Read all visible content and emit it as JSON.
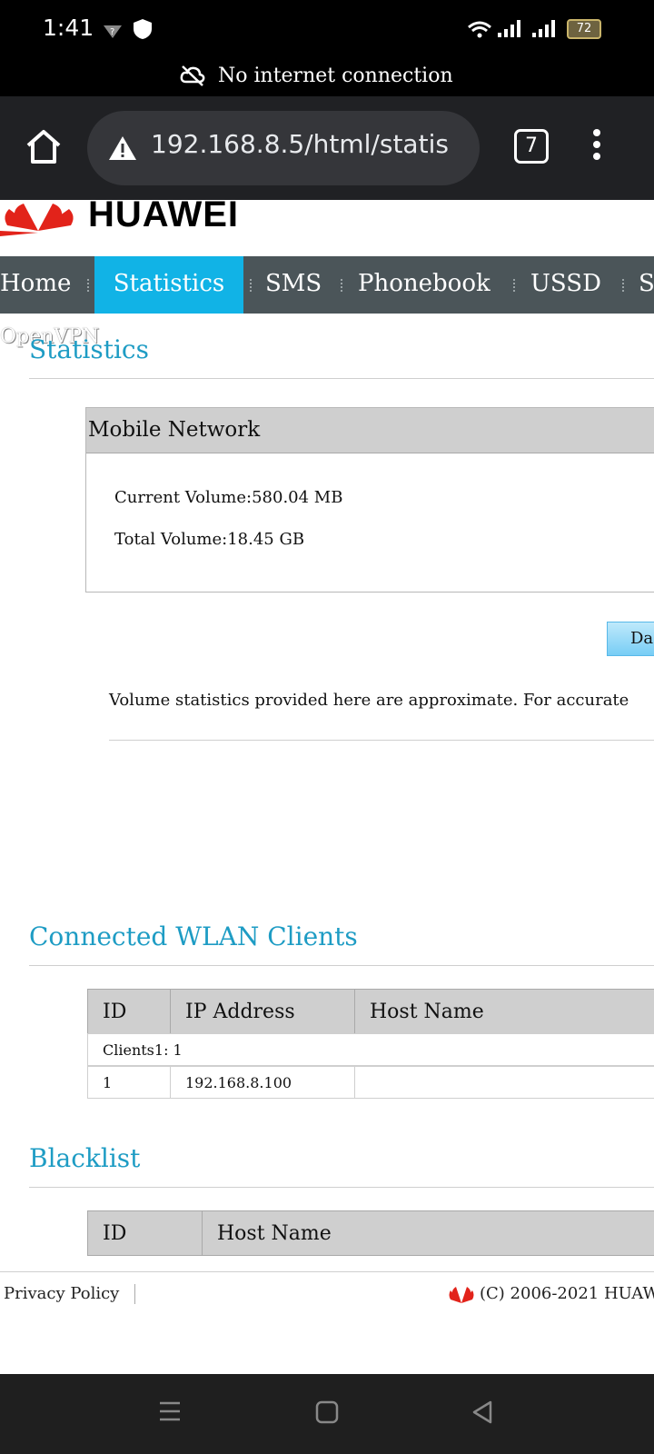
{
  "status_bar": {
    "time": "1:41",
    "battery": "72",
    "icons": [
      "vpn-key-icon",
      "shield-icon",
      "wifi-icon",
      "signal-icon",
      "signal-icon",
      "battery-icon"
    ]
  },
  "network_banner": {
    "text": "No internet connection",
    "icon": "cloud-off-icon"
  },
  "browser": {
    "url": "192.168.8.5/html/statis",
    "tab_count": "7"
  },
  "site": {
    "brand": "HUAWEI",
    "nav": [
      "Home",
      "Statistics",
      "SMS",
      "Phonebook",
      "USSD",
      "S"
    ],
    "active_nav": "Statistics",
    "overlay_text": "OpenVPN"
  },
  "statistics": {
    "title": "Statistics",
    "panel_title": "Mobile Network",
    "current_volume": "Current Volume:580.04 MB",
    "total_volume": "Total Volume:18.45 GB",
    "button_label": "Da",
    "note": "Volume statistics provided here are approximate. For accurate"
  },
  "wlan": {
    "title": "Connected WLAN Clients",
    "headers": [
      "ID",
      "IP Address",
      "Host Name"
    ],
    "clients_summary": "Clients1: 1",
    "rows": [
      {
        "id": "1",
        "ip": "192.168.8.100",
        "host": ""
      }
    ]
  },
  "blacklist": {
    "title": "Blacklist",
    "headers": [
      "ID",
      "Host Name"
    ]
  },
  "footer": {
    "privacy": "Privacy Policy",
    "copyright": "(C) 2006-2021 HUAW"
  }
}
